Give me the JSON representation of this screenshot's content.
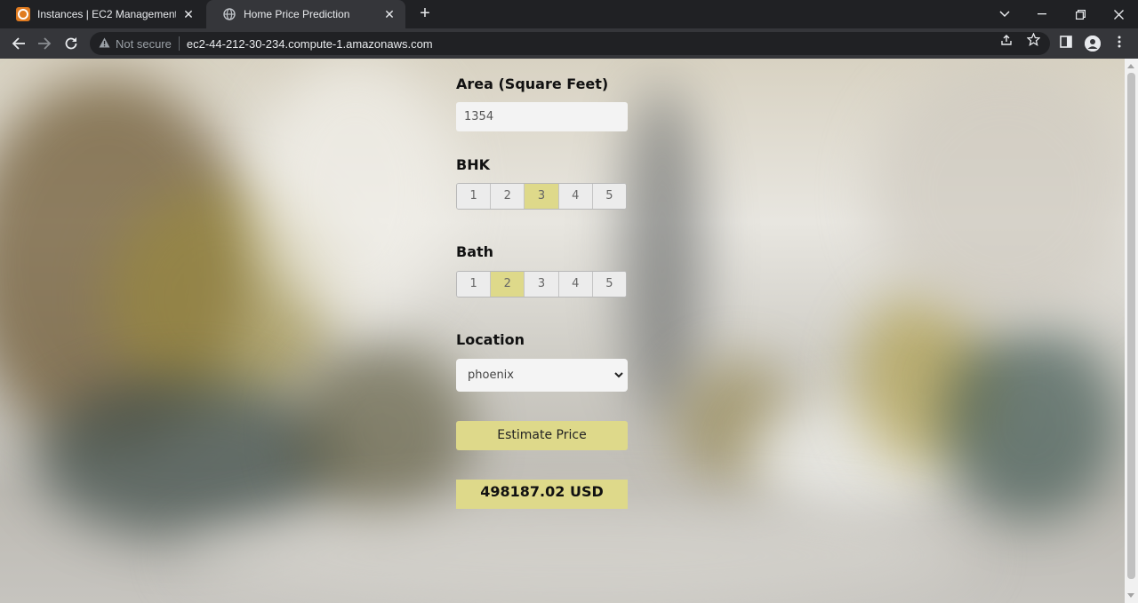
{
  "browser": {
    "tabs": [
      {
        "title": "Instances | EC2 Management Con",
        "active": false,
        "favicon": "aws-icon"
      },
      {
        "title": "Home Price Prediction",
        "active": true,
        "favicon": "globe-icon"
      }
    ],
    "security_label": "Not secure",
    "url": "ec2-44-212-30-234.compute-1.amazonaws.com"
  },
  "form": {
    "area_label": "Area (Square Feet)",
    "area_value": "1354",
    "bhk_label": "BHK",
    "bhk_options": [
      "1",
      "2",
      "3",
      "4",
      "5"
    ],
    "bhk_selected": "3",
    "bath_label": "Bath",
    "bath_options": [
      "1",
      "2",
      "3",
      "4",
      "5"
    ],
    "bath_selected": "2",
    "location_label": "Location",
    "location_value": "phoenix",
    "estimate_button": "Estimate Price",
    "result": "498187.02 USD"
  },
  "colors": {
    "accent": "#ded98a",
    "chrome_dark": "#202124",
    "chrome_toolbar": "#35363a"
  }
}
